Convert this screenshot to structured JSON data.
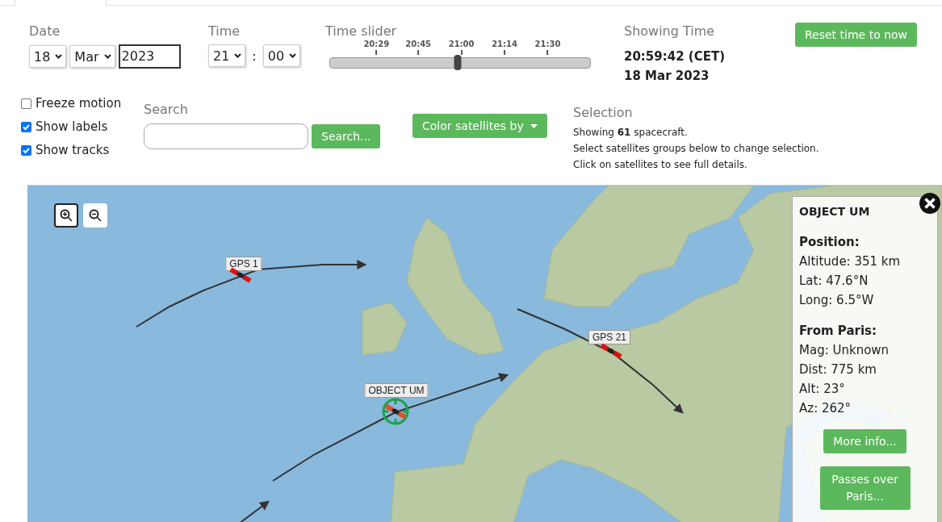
{
  "date": {
    "label": "Date",
    "day": "18",
    "month": "Mar",
    "year": "2023"
  },
  "time": {
    "label": "Time",
    "hour": "21",
    "separator": ":",
    "minute": "00"
  },
  "time_slider": {
    "label": "Time slider",
    "ticks": [
      "20:29",
      "20:45",
      "21:00",
      "21:14",
      "21:30"
    ],
    "level": 0.49
  },
  "showing_time": {
    "label": "Showing Time",
    "time": "20:59:42 (CET)",
    "date": "18 Mar 2023"
  },
  "reset_button": "Reset time to now",
  "options": [
    {
      "label": "Freeze motion",
      "checked": false
    },
    {
      "label": "Show labels",
      "checked": true
    },
    {
      "label": "Show tracks",
      "checked": true
    }
  ],
  "search": {
    "label": "Search",
    "button": "Search..."
  },
  "color_button": "Color satellites by",
  "selection": {
    "label": "Selection",
    "lines": [
      "Showing **61** spacecraft.",
      "Select satellites groups below to change selection.",
      "Click on satellites to see full details."
    ]
  },
  "map": {
    "satellites": [
      {
        "label": "GPS 1",
        "selected": false
      },
      {
        "label": "GPS 21",
        "selected": false
      },
      {
        "label": "OBJECT UM",
        "selected": true
      }
    ],
    "popup": {
      "title": "OBJECT UM",
      "sections": [
        {
          "heading": "Position:",
          "lines": [
            "Altitude: 351 km",
            "Lat: 47.6°N",
            "Long: 6.5°W"
          ]
        },
        {
          "heading": "From Paris:",
          "lines": [
            "Mag: Unknown",
            "Dist: 775 km",
            "Alt: 23°",
            "Az: 262°"
          ]
        }
      ],
      "buttons": [
        "More info...",
        "Passes over Paris..."
      ]
    }
  }
}
